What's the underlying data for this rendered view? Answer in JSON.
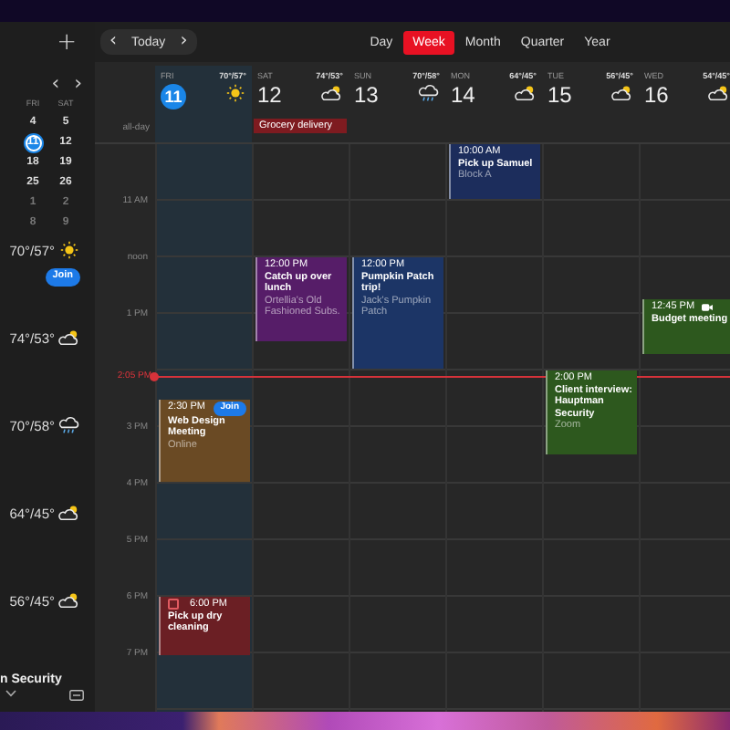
{
  "toolbar": {
    "add": "+",
    "prev": "‹",
    "today": "Today",
    "next": "›",
    "views": [
      {
        "label": "Day",
        "selected": false
      },
      {
        "label": "Week",
        "selected": true
      },
      {
        "label": "Month",
        "selected": false
      },
      {
        "label": "Quarter",
        "selected": false
      },
      {
        "label": "Year",
        "selected": false
      }
    ]
  },
  "mini_calendar": {
    "prev": "‹",
    "next": "›",
    "columns": [
      {
        "day": "FRI",
        "dates": [
          {
            "label": "4",
            "selected": false,
            "other_month": false
          },
          {
            "label": "11",
            "selected": true,
            "other_month": false
          },
          {
            "label": "18",
            "selected": false,
            "other_month": false
          },
          {
            "label": "25",
            "selected": false,
            "other_month": false
          },
          {
            "label": "1",
            "selected": false,
            "other_month": true
          },
          {
            "label": "8",
            "selected": false,
            "other_month": true
          }
        ]
      },
      {
        "day": "SAT",
        "dates": [
          {
            "label": "5",
            "selected": false,
            "other_month": false
          },
          {
            "label": "12",
            "selected": false,
            "other_month": false
          },
          {
            "label": "19",
            "selected": false,
            "other_month": false
          },
          {
            "label": "26",
            "selected": false,
            "other_month": false
          },
          {
            "label": "2",
            "selected": false,
            "other_month": true
          },
          {
            "label": "9",
            "selected": false,
            "other_month": true
          }
        ]
      }
    ]
  },
  "agenda": [
    {
      "weather": "70°/57°",
      "kind": "sun",
      "join": "Join"
    },
    {
      "weather": "74°/53°",
      "kind": "cloud-sun"
    },
    {
      "weather": "70°/58°",
      "kind": "rain"
    },
    {
      "weather": "64°/45°",
      "kind": "cloud-sun"
    },
    {
      "weather": "56°/45°",
      "kind": "cloud-sun"
    }
  ],
  "agenda_footer": {
    "title": "n Security"
  },
  "all_day_label": "all-day",
  "time_labels": [
    {
      "label": "11 AM"
    },
    {
      "label": "noon"
    },
    {
      "label": "1 PM"
    },
    {
      "label": "3 PM"
    },
    {
      "label": "4 PM"
    },
    {
      "label": "5 PM"
    },
    {
      "label": "6 PM"
    },
    {
      "label": "7 PM"
    }
  ],
  "current_time": {
    "label": "2:05 PM"
  },
  "days": [
    {
      "name": "FRI",
      "number": "11",
      "today": true,
      "weather": "70°/57°",
      "kind": "sun",
      "events": [
        {
          "time": "2:30 PM",
          "title": "Web Design Meeting",
          "location": "Online",
          "color": "#6a4a24",
          "join": "Join"
        },
        {
          "time": "6:00 PM",
          "title": "Pick up dry cleaning",
          "color": "#6b1f24",
          "task_checked": false
        }
      ]
    },
    {
      "name": "SAT",
      "number": "12",
      "today": false,
      "weather": "74°/53°",
      "kind": "cloud-sun",
      "all_day": [
        {
          "title": "Grocery delivery",
          "color": "#7e1b20"
        }
      ],
      "events": [
        {
          "time": "12:00 PM",
          "title": "Catch up over lunch",
          "location": "Ortellia's Old Fashioned Subs.",
          "color": "#561d68"
        }
      ]
    },
    {
      "name": "SUN",
      "number": "13",
      "today": false,
      "weather": "70°/58°",
      "kind": "rain",
      "events": [
        {
          "time": "12:00 PM",
          "title": "Pumpkin Patch trip!",
          "location": "Jack's Pumpkin Patch",
          "color": "#1c3566"
        }
      ]
    },
    {
      "name": "MON",
      "number": "14",
      "today": false,
      "weather": "64°/45°",
      "kind": "cloud-sun",
      "events": [
        {
          "time": "10:00 AM",
          "title": "Pick up Samuel",
          "location": "Block A",
          "color": "#1c2d5c"
        }
      ]
    },
    {
      "name": "TUE",
      "number": "15",
      "today": false,
      "weather": "56°/45°",
      "kind": "cloud-sun",
      "events": [
        {
          "time": "2:00 PM",
          "title": "Client interview: Hauptman Security",
          "location": "Zoom",
          "color": "#2d581e"
        }
      ]
    },
    {
      "name": "WED",
      "number": "16",
      "today": false,
      "weather": "54°/45°",
      "kind": "cloud-sun",
      "events": [
        {
          "time": "12:45 PM",
          "title": "Budget meeting",
          "color": "#2d581e",
          "video": true
        }
      ]
    }
  ]
}
